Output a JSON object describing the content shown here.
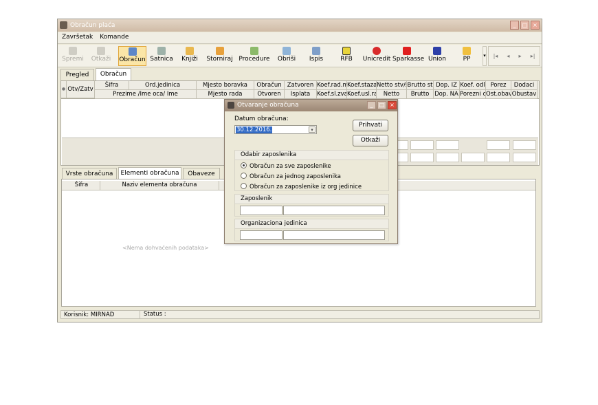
{
  "window": {
    "title": "Obračun plaća"
  },
  "menu": [
    "Završetak",
    "Komande"
  ],
  "toolbar": {
    "buttons": [
      {
        "label": "Spremi",
        "icon": "save-icon",
        "enabled": false
      },
      {
        "label": "Otkaži",
        "icon": "cancel-icon",
        "enabled": false
      },
      {
        "label": "Obračun",
        "icon": "calculation-icon",
        "active": true
      },
      {
        "label": "Satnica",
        "icon": "hours-icon"
      },
      {
        "label": "Knjiži",
        "icon": "post-icon"
      },
      {
        "label": "Storniraj",
        "icon": "reverse-icon"
      },
      {
        "label": "Procedure",
        "icon": "procedure-icon"
      },
      {
        "label": "Obriši",
        "icon": "delete-icon"
      },
      {
        "label": "Ispis",
        "icon": "print-icon"
      },
      {
        "label": "RFB",
        "icon": "rfb-bank-icon"
      },
      {
        "label": "Unicredit",
        "icon": "unicredit-bank-icon"
      },
      {
        "label": "Sparkasse",
        "icon": "sparkasse-bank-icon"
      },
      {
        "label": "Union",
        "icon": "union-bank-icon"
      },
      {
        "label": "PP",
        "icon": "pp-icon"
      }
    ]
  },
  "top_tabs": [
    "Pregled",
    "Obračun"
  ],
  "grid": {
    "col_otvzatv": "Otv/Zatv",
    "row1": [
      "Šifra",
      "Ord.jedinica",
      "Mjesto boravka",
      "Obračun",
      "Zatvoren",
      "Koef.rad.m",
      "Koef.staza",
      "Netto stv/s",
      "Brutto st",
      "Dop. IZ",
      "Koef. odl",
      "Porez",
      "Dodaci"
    ],
    "row2": [
      "Prezime /Ime oca/ Ime",
      "Mjesto rada",
      "Otvoren",
      "Isplata",
      "Koef.sl.zva",
      "Koef.usl.ra",
      "Netto",
      "Brutto",
      "Dop. NA",
      "Porezni c",
      "Ost.obav",
      "Obustav"
    ]
  },
  "bottom_tabs": [
    "Vrste obračuna",
    "Elementi obračuna",
    "Obaveze"
  ],
  "bottom_grid": {
    "headers": [
      "Šifra",
      "Naziv elementa obračuna"
    ],
    "empty_text": "<Nema dohvaćenih podataka>"
  },
  "status": {
    "user": "Korisnik: MIRNAD",
    "status": "Status :"
  },
  "dialog": {
    "title": "Otvaranje obračuna",
    "date_label": "Datum obračuna:",
    "date_value": "30.12.2016.",
    "accept": "Prihvati",
    "cancel": "Otkaži",
    "group_title": "Odabir zaposlenika",
    "options": [
      "Obračun za sve zaposlenike",
      "Obračun za jednog zaposlenika",
      "Obračun za zaposlenike iz org jedinice"
    ],
    "employee_label": "Zaposlenik",
    "org_label": "Organizaciona jedinica"
  },
  "colors": {
    "active_button": "#fbe6a7",
    "selection": "#316ac5",
    "titlebar": "#cfbba6"
  }
}
